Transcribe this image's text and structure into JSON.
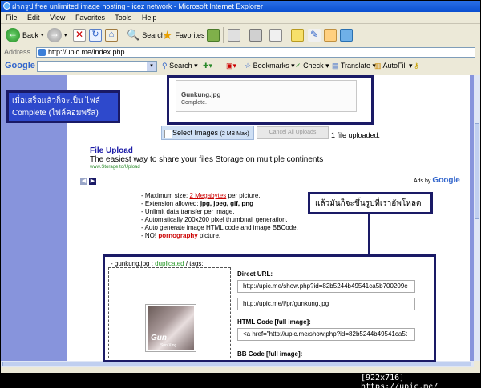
{
  "window": {
    "title": "ฝากรูป free unlimited image hosting - icez network - Microsoft Internet Explorer"
  },
  "menu": [
    "File",
    "Edit",
    "View",
    "Favorites",
    "Tools",
    "Help"
  ],
  "toolbar": {
    "back": "Back",
    "search": "Search",
    "favorites": "Favorites"
  },
  "address": {
    "label": "Address",
    "url": "http://upic.me/index.php"
  },
  "google_toolbar": {
    "logo": "Google",
    "search_label": "Search",
    "bookmarks": "Bookmarks",
    "check": "Check",
    "translate": "Translate",
    "autofill": "AutoFill"
  },
  "upload": {
    "filename": "Gunkung.jpg",
    "status": "Complete.",
    "select_button": "Select Images",
    "select_max": "(2 MB Max)",
    "cancel_button": "Cancel All Uploads",
    "count_text": "1 file uploaded."
  },
  "ad": {
    "title": "File Upload",
    "description": "The easiest way to share your files Storage on multiple continents",
    "url": "www.Storage.to/Upload",
    "ads_by": "Ads by",
    "ads_brand": "Google"
  },
  "rules": {
    "max_size_prefix": "- Maximum size: ",
    "max_size_value": "2 Megabytes",
    "max_size_suffix": " per picture.",
    "ext_prefix": "- Extension allowed: ",
    "ext_value": "jpg, jpeg, gif, png",
    "unlimited": "- Unlimit data transfer per image.",
    "thumbnail": "- Automatically 200x200 pixel thumbnail generation.",
    "generate": "- Auto generate image HTML code and image BBCode.",
    "no_prefix": "- NO! ",
    "no_value": "pornography",
    "no_suffix": " picture."
  },
  "result": {
    "header_prefix": "- gunkung.jpg : ",
    "header_dup": "duplicated",
    "header_suffix": " / tags:",
    "thumb_text": "Gun",
    "thumb_sub": "Sun Xing",
    "direct_label": "Direct URL:",
    "direct_url": "http://upic.me/show.php?id=82b5244b49541ca5b700209e",
    "short_url": "http://upic.me/i/pr/gunkung.jpg",
    "html_label": "HTML Code [full image]:",
    "html_code": "<a href=\"http://upic.me/show.php?id=82b5244b49541ca5t",
    "bb_label": "BB Code [full image]:"
  },
  "annotations": {
    "left_line1": "เมื่อเสร็จแล้วก็จะเป็น ไฟล์",
    "left_line2": "Complete (ไฟล์คอมพรีส)",
    "right_text": "แล้วมันก็จะขึ้นรูปที่เราอัพโหลด"
  },
  "caption": "[922x716] https://upic.me/"
}
